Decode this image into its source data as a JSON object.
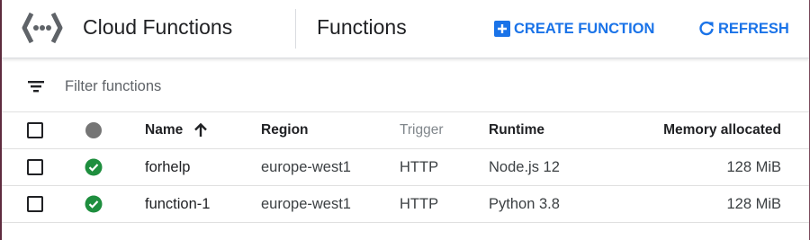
{
  "header": {
    "product_title": "Cloud Functions",
    "page_title": "Functions",
    "create_label": "CREATE FUNCTION",
    "refresh_label": "REFRESH",
    "logo_icon": "cloud-functions-logo-icon",
    "accent_color": "#1a73e8"
  },
  "filter": {
    "placeholder": "Filter functions",
    "value": ""
  },
  "table": {
    "columns": {
      "name": "Name",
      "region": "Region",
      "trigger": "Trigger",
      "runtime": "Runtime",
      "memory": "Memory allocated"
    },
    "sort": {
      "column": "name",
      "direction": "ascending"
    },
    "rows": [
      {
        "name": "forhelp",
        "region": "europe-west1",
        "trigger": "HTTP",
        "runtime": "Node.js 12",
        "memory": "128 MiB",
        "status": "ok"
      },
      {
        "name": "function-1",
        "region": "europe-west1",
        "trigger": "HTTP",
        "runtime": "Python 3.8",
        "memory": "128 MiB",
        "status": "ok"
      }
    ]
  },
  "colors": {
    "status_ok": "#1e8e3e",
    "status_header": "#757575"
  }
}
